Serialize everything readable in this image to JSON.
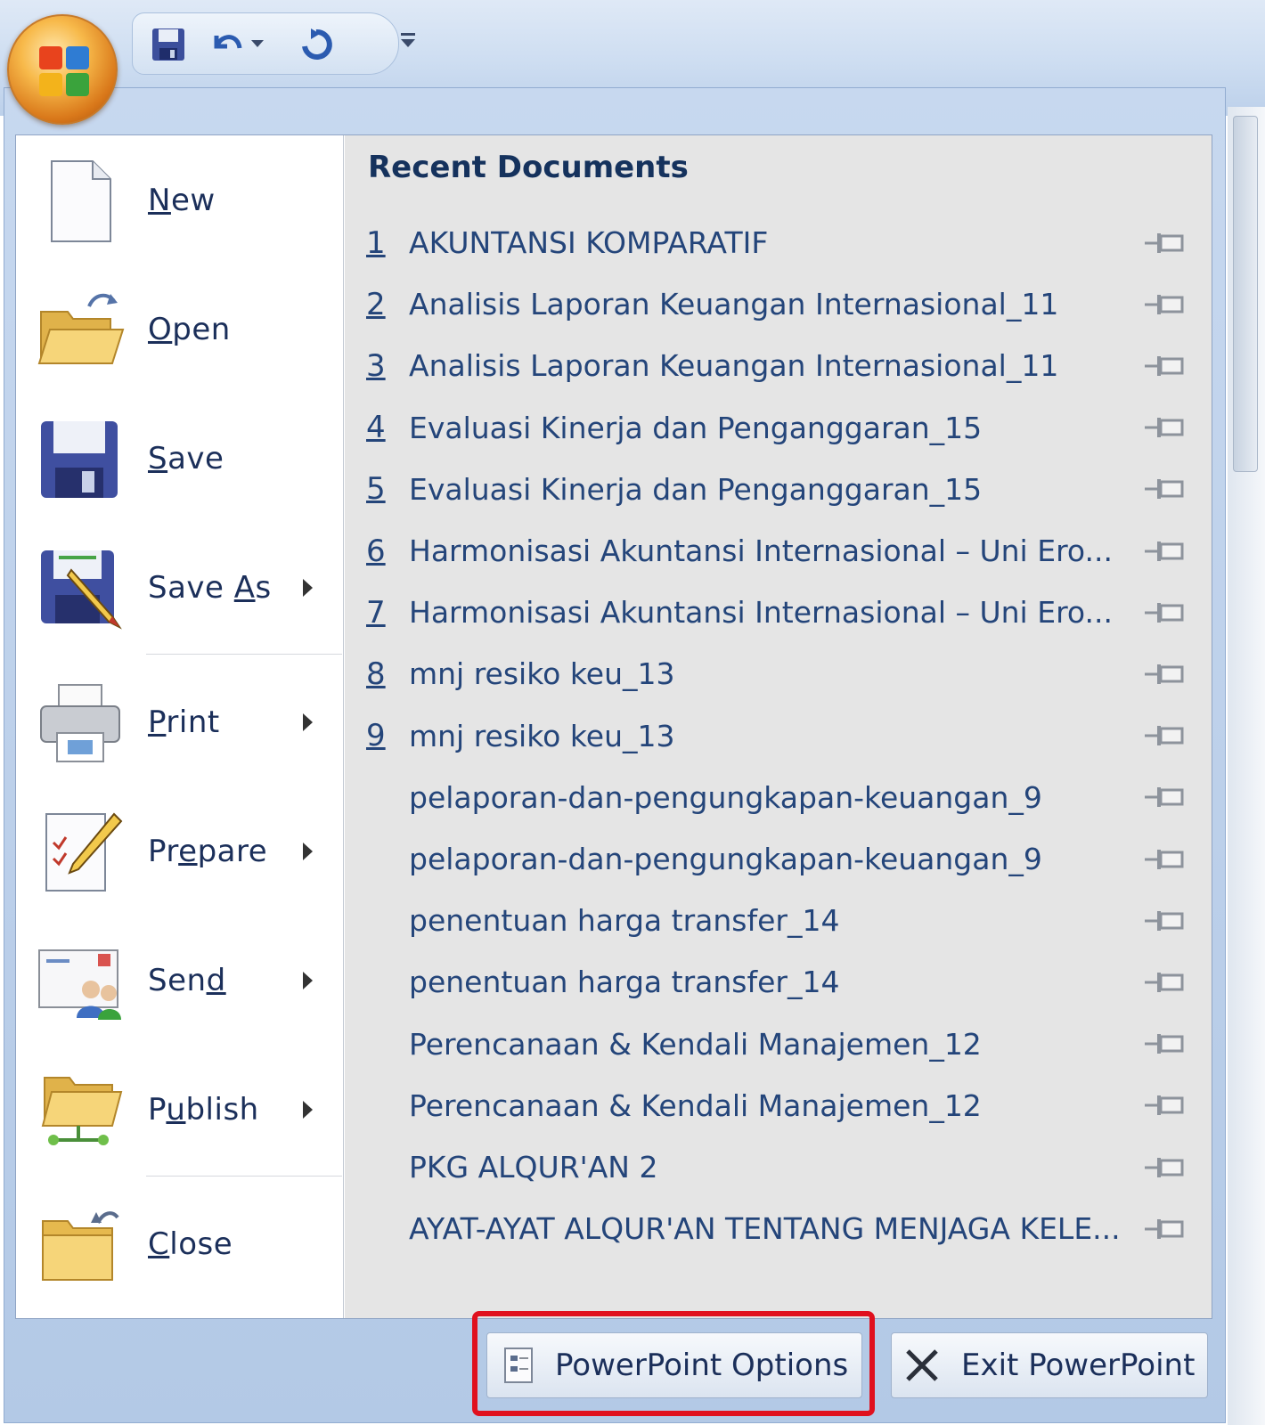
{
  "quick_access": {
    "save_icon": "save-icon",
    "undo_icon": "undo-icon",
    "redo_icon": "redo-icon",
    "customize_icon": "customize-dropdown-icon"
  },
  "commands": [
    {
      "label": "New",
      "key": "N",
      "rest": "ew",
      "icon": "new-document-icon",
      "submenu": false
    },
    {
      "label": "Open",
      "key": "O",
      "rest": "pen",
      "icon": "open-folder-icon",
      "submenu": false
    },
    {
      "label": "Save",
      "key": "S",
      "rest": "ave",
      "icon": "save-icon",
      "submenu": false
    },
    {
      "label": "Save As",
      "pre": "Save ",
      "key": "A",
      "rest": "s",
      "icon": "save-as-icon",
      "submenu": true
    },
    {
      "label": "Print",
      "key": "P",
      "rest": "rint",
      "icon": "printer-icon",
      "submenu": true
    },
    {
      "label": "Prepare",
      "pre": "Pr",
      "key": "e",
      "rest": "pare",
      "icon": "prepare-icon",
      "submenu": true
    },
    {
      "label": "Send",
      "pre": "Sen",
      "key": "d",
      "rest": "",
      "icon": "send-icon",
      "submenu": true
    },
    {
      "label": "Publish",
      "pre": "P",
      "key": "u",
      "rest": "blish",
      "icon": "publish-icon",
      "submenu": true
    },
    {
      "label": "Close",
      "key": "C",
      "rest": "lose",
      "icon": "close-folder-icon",
      "submenu": false
    }
  ],
  "recent": {
    "title": "Recent Documents",
    "items": [
      {
        "num": "1",
        "name": "AKUNTANSI KOMPARATIF"
      },
      {
        "num": "2",
        "name": "Analisis Laporan Keuangan Internasional_11"
      },
      {
        "num": "3",
        "name": "Analisis Laporan Keuangan Internasional_11"
      },
      {
        "num": "4",
        "name": "Evaluasi Kinerja dan Penganggaran_15"
      },
      {
        "num": "5",
        "name": "Evaluasi Kinerja dan Penganggaran_15"
      },
      {
        "num": "6",
        "name": "Harmonisasi Akuntansi Internasional – Uni Ero..."
      },
      {
        "num": "7",
        "name": "Harmonisasi Akuntansi Internasional – Uni Ero..."
      },
      {
        "num": "8",
        "name": "mnj resiko keu_13"
      },
      {
        "num": "9",
        "name": "mnj resiko keu_13"
      },
      {
        "num": "",
        "name": "pelaporan-dan-pengungkapan-keuangan_9"
      },
      {
        "num": "",
        "name": "pelaporan-dan-pengungkapan-keuangan_9"
      },
      {
        "num": "",
        "name": "penentuan harga transfer_14"
      },
      {
        "num": "",
        "name": "penentuan harga transfer_14"
      },
      {
        "num": "",
        "name": "Perencanaan & Kendali Manajemen_12"
      },
      {
        "num": "",
        "name": "Perencanaan & Kendali Manajemen_12"
      },
      {
        "num": "",
        "name": "PKG ALQUR'AN 2"
      },
      {
        "num": "",
        "name": "AYAT-AYAT ALQUR'AN TENTANG MENJAGA KELE..."
      }
    ]
  },
  "footer": {
    "options_label": "PowerPoint Options",
    "exit_label": "Exit PowerPoint"
  },
  "colors": {
    "highlight": "#e0101e",
    "menu_blue": "#c7d8ef",
    "text_blue": "#24457a"
  }
}
